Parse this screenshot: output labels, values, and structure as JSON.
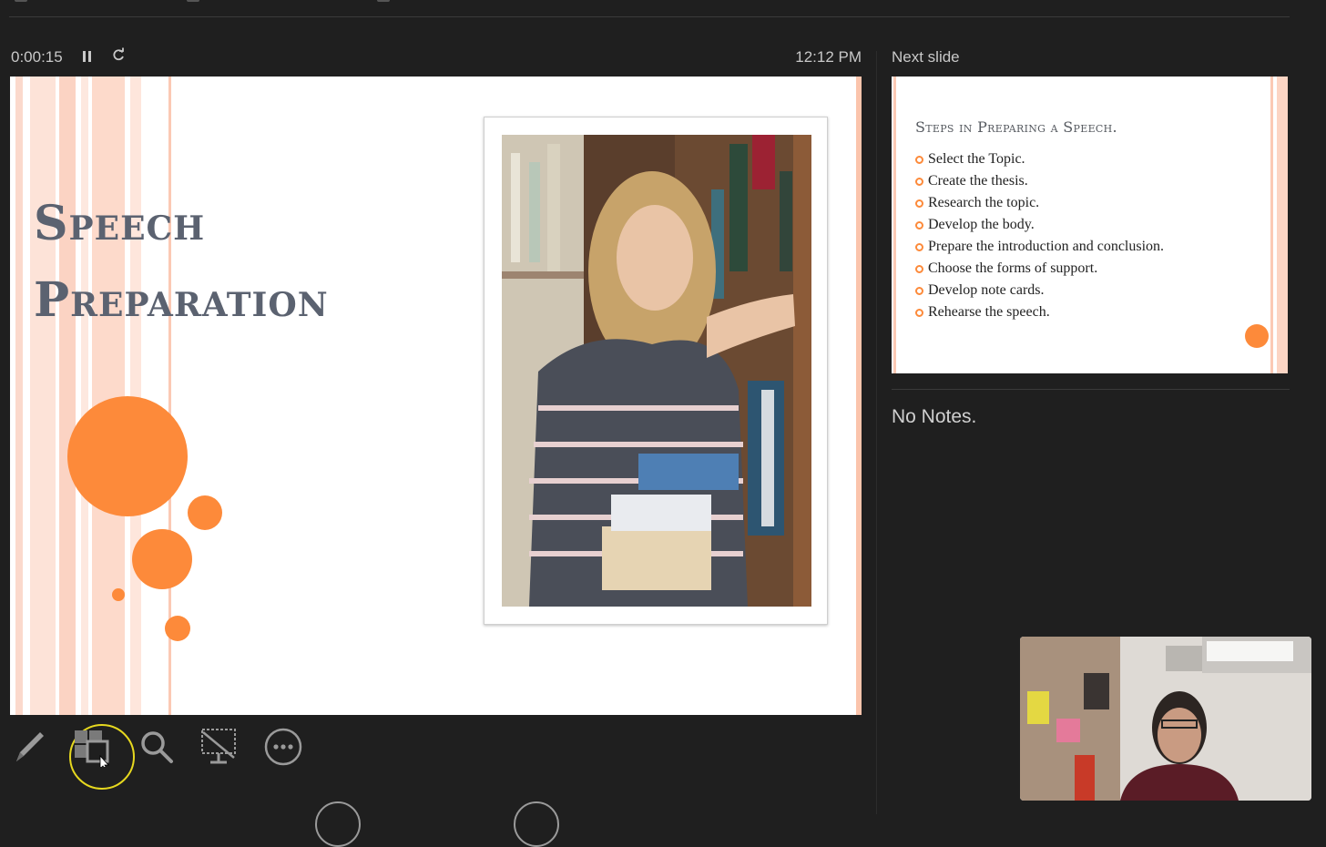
{
  "timer": {
    "elapsed": "0:00:15",
    "clock": "12:12 PM"
  },
  "current_slide": {
    "title_line1": "Speech",
    "title_line2": "Preparation"
  },
  "next_slide": {
    "label": "Next slide",
    "title": "Steps in Preparing a Speech.",
    "items": [
      "Select the Topic.",
      "Create the thesis.",
      "Research the topic.",
      "Develop the body.",
      "Prepare the introduction and conclusion.",
      "Choose the forms of support.",
      "Develop note cards.",
      "Rehearse the speech."
    ]
  },
  "notes": {
    "text": "No Notes."
  },
  "toolbar": {
    "icons": [
      "pen-icon",
      "slides-grid-icon",
      "zoom-icon",
      "black-screen-icon",
      "more-options-icon"
    ]
  },
  "colors": {
    "accent_orange": "#fd8a3a",
    "title_slate": "#5b6270",
    "background": "#1f1f1f",
    "highlight": "#e6d81f"
  }
}
